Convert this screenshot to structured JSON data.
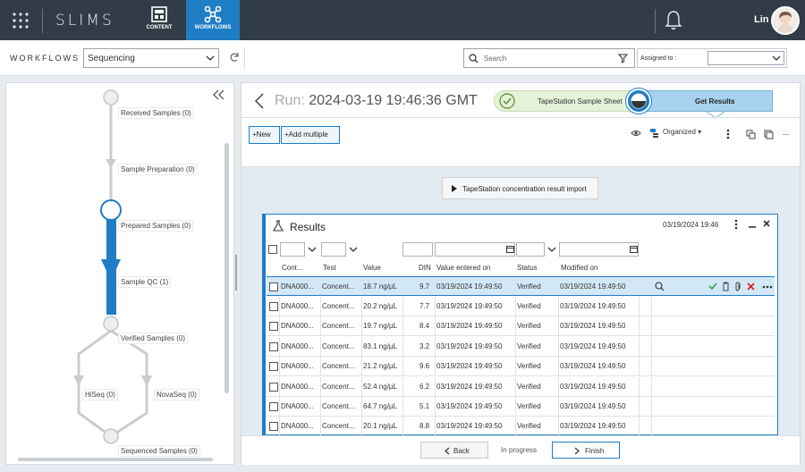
{
  "header": {
    "brand": "SLIMS",
    "nav": [
      {
        "label": "CONTENT",
        "icon": "content-icon"
      },
      {
        "label": "WORKFLOWS",
        "icon": "workflows-icon",
        "active": true
      }
    ],
    "user": "Lin",
    "accent": "#1f7dc6",
    "bar_color": "#323c48"
  },
  "toolbar": {
    "workflows_label": "WORKFLOWS",
    "workflow_value": "Sequencing",
    "search_placeholder": "Search",
    "assigned_label": "Assigned to :",
    "assigned_value": ""
  },
  "workflow_steps": [
    {
      "label": "Received Samples (0)",
      "state": "done"
    },
    {
      "label": "Sample Preparation (0)",
      "state": "done"
    },
    {
      "label": "Prepared Samples (0)",
      "state": "current"
    },
    {
      "label": "Sample QC (1)",
      "state": "active"
    },
    {
      "label": "Verified Samples (0)",
      "state": "pending"
    },
    {
      "label": "HiSeq (0)",
      "state": "pending"
    },
    {
      "label": "NovaSeq (0)",
      "state": "pending"
    },
    {
      "label": "Sequenced Samples (0)",
      "state": "pending"
    }
  ],
  "run": {
    "label": "Run:",
    "title": "2024-03-19 19:46:36 GMT",
    "steps": [
      {
        "label": "TapeStation Sample Sheet",
        "state": "complete"
      },
      {
        "label": "Get Results",
        "state": "active"
      }
    ]
  },
  "actions": {
    "new": "New",
    "add_multiple": "Add multiple",
    "organized": "Organized",
    "more": "..."
  },
  "import_button": "TapeStation concentration result import",
  "results": {
    "title": "Results",
    "date": "03/19/2024 19:46",
    "columns": [
      "Cont...",
      "Test",
      "Value",
      "DIN",
      "Value entered on",
      "Status",
      "Modified on"
    ],
    "rows": [
      [
        "DNA000...",
        "Concent...",
        "18.7 ng/µL",
        "9.7",
        "03/19/2024 19:49:50",
        "Verified",
        "03/19/2024 19:49:50"
      ],
      [
        "DNA000...",
        "Concent...",
        "20.2 ng/µL",
        "7.7",
        "03/19/2024 19:49:50",
        "Verified",
        "03/19/2024 19:49:50"
      ],
      [
        "DNA000...",
        "Concent...",
        "19.7 ng/µL",
        "8.4",
        "03/19/2024 19:49:50",
        "Verified",
        "03/19/2024 19:49:50"
      ],
      [
        "DNA000...",
        "Concent...",
        "83.1 ng/µL",
        "3.2",
        "03/19/2024 19:49:50",
        "Verified",
        "03/19/2024 19:49:50"
      ],
      [
        "DNA000...",
        "Concent...",
        "21.2 ng/µL",
        "9.6",
        "03/19/2024 19:49:50",
        "Verified",
        "03/19/2024 19:49:50"
      ],
      [
        "DNA000...",
        "Concent...",
        "52.4 ng/µL",
        "6.2",
        "03/19/2024 19:49:50",
        "Verified",
        "03/19/2024 19:49:50"
      ],
      [
        "DNA000...",
        "Concent...",
        "64.7 ng/µL",
        "5.1",
        "03/19/2024 19:49:50",
        "Verified",
        "03/19/2024 19:49:50"
      ],
      [
        "DNA000...",
        "Concent...",
        "20.1 ng/µL",
        "8.8",
        "03/19/2024 19:49:50",
        "Verified",
        "03/19/2024 19:49:50"
      ]
    ]
  },
  "footer": {
    "back": "Back",
    "status": "In progress",
    "finish": "Finish"
  }
}
